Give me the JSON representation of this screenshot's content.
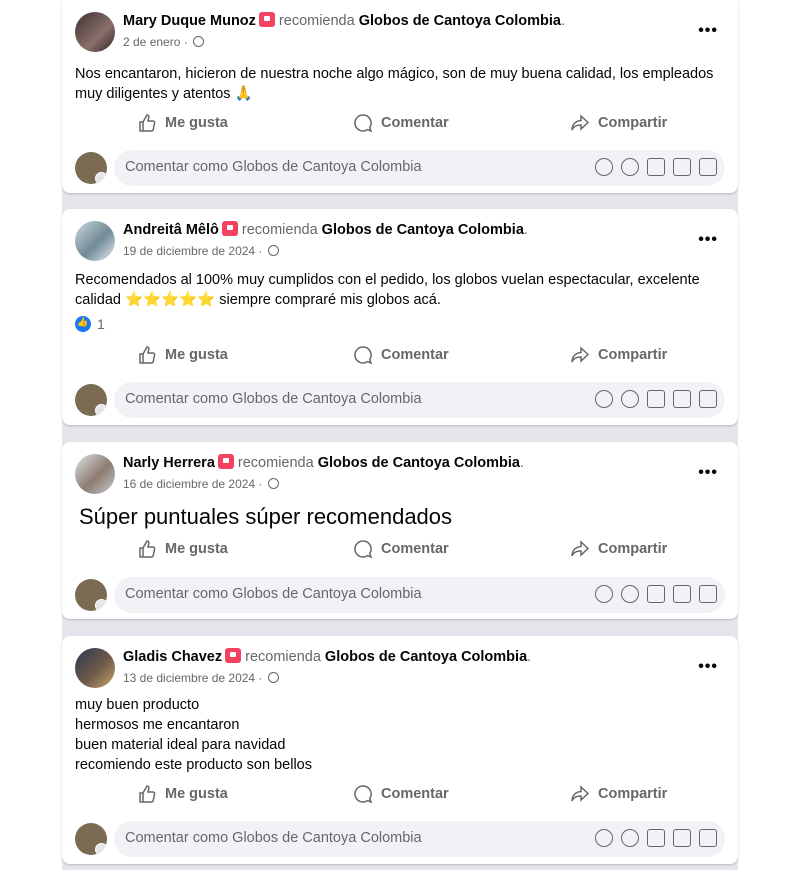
{
  "posts": [
    {
      "author": "Mary Duque Munoz",
      "recommends": "recomienda",
      "page": "Globos de Cantoya Colombia",
      "date": "2 de enero",
      "lines": [
        "Nos encantaron, hicieron de nuestra noche algo mágico, son de muy buena calidad, los empleados",
        "muy diligentes y atentos 🙏"
      ],
      "reaction_count": ""
    },
    {
      "author": "Andreitâ Mêlô",
      "recommends": "recomienda",
      "page": "Globos de Cantoya Colombia",
      "date": "19 de diciembre de 2024",
      "lines": [
        "Recomendados al 100% muy cumplidos con el pedido, los globos vuelan espectacular, excelente",
        "calidad ⭐⭐⭐⭐⭐ siempre compraré mis globos acá."
      ],
      "reaction_count": "1"
    },
    {
      "author": "Narly Herrera",
      "recommends": "recomienda",
      "page": "Globos de Cantoya Colombia",
      "date": "16 de diciembre de 2024",
      "lines": [
        "Súper puntuales súper recomendados"
      ],
      "reaction_count": ""
    },
    {
      "author": "Gladis Chavez",
      "recommends": "recomienda",
      "page": "Globos de Cantoya Colombia",
      "date": "13 de diciembre de 2024",
      "lines": [
        "muy buen producto",
        "hermosos me encantaron",
        "buen material ideal para navidad",
        "recomiendo este producto son bellos"
      ],
      "reaction_count": ""
    }
  ],
  "actions": {
    "like": "Me gusta",
    "comment": "Comentar",
    "share": "Compartir"
  },
  "comment_placeholder": "Comentar como Globos de Cantoya Colombia",
  "more_label": "•••",
  "icons": [
    "more-icon",
    "globe-icon",
    "recommend-badge-icon",
    "like-icon",
    "comment-icon",
    "share-icon",
    "avatar-icon",
    "emoji-icon",
    "camera-icon",
    "gif-icon",
    "sticker-icon"
  ],
  "colors": {
    "like_blue": "#1877f2",
    "badge_red": "#f3425f",
    "muted_text": "#65676b",
    "feed_bg": "#e4e6eb"
  }
}
